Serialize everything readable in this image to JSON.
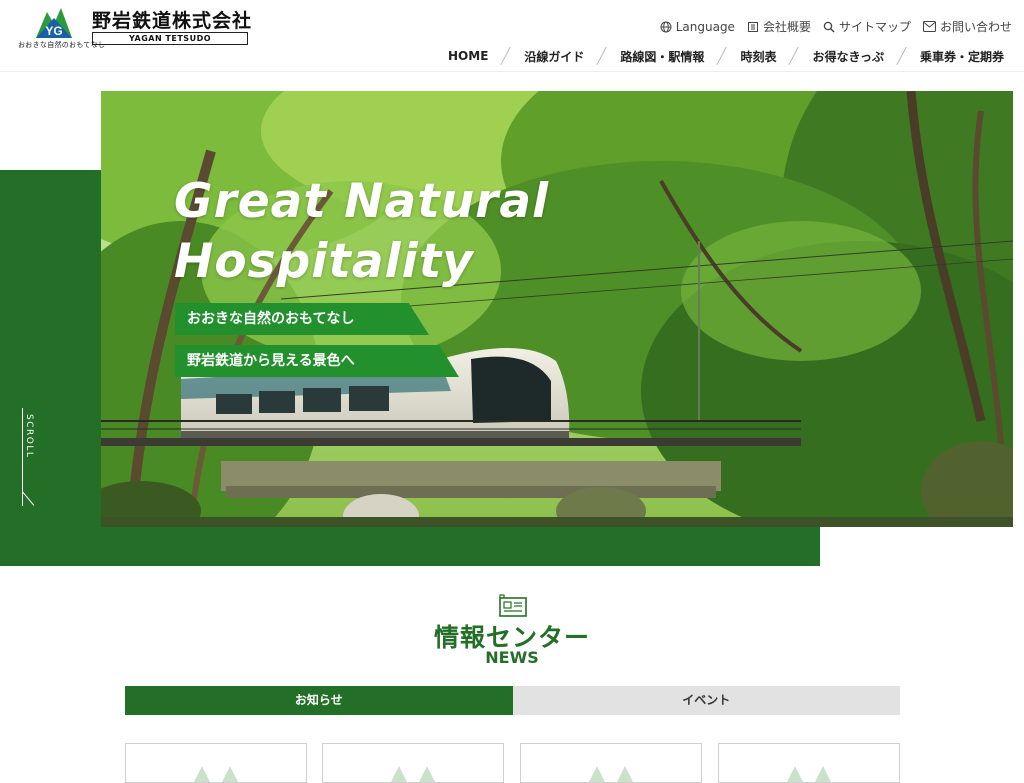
{
  "header": {
    "tagline": "おおきな自然のおもてなし",
    "company_name": "野岩鉄道株式会社",
    "company_roman": "YAGAN TETSUDO",
    "utility": [
      {
        "label": "Language",
        "icon": "globe-icon"
      },
      {
        "label": "会社概要",
        "icon": "building-icon"
      },
      {
        "label": "サイトマップ",
        "icon": "search-icon"
      },
      {
        "label": "お問い合わせ",
        "icon": "mail-icon"
      }
    ],
    "nav": [
      "HOME",
      "沿線ガイド",
      "路線図・駅情報",
      "時刻表",
      "お得なきっぷ",
      "乗車券・定期券"
    ]
  },
  "hero": {
    "title_line1": "Great Natural",
    "title_line2": "Hospitality",
    "ribbon1": "おおきな自然のおもてなし",
    "ribbon2": "野岩鉄道から見える景色へ",
    "scroll_label": "SCROLL"
  },
  "news": {
    "title": "情報センター",
    "subtitle": "NEWS",
    "tabs": [
      "お知らせ",
      "イベント"
    ],
    "active_tab": "お知らせ"
  },
  "colors": {
    "brand_green": "#236f27",
    "ribbon_green": "#23902e",
    "tab_inactive": "#e2e2e2"
  }
}
